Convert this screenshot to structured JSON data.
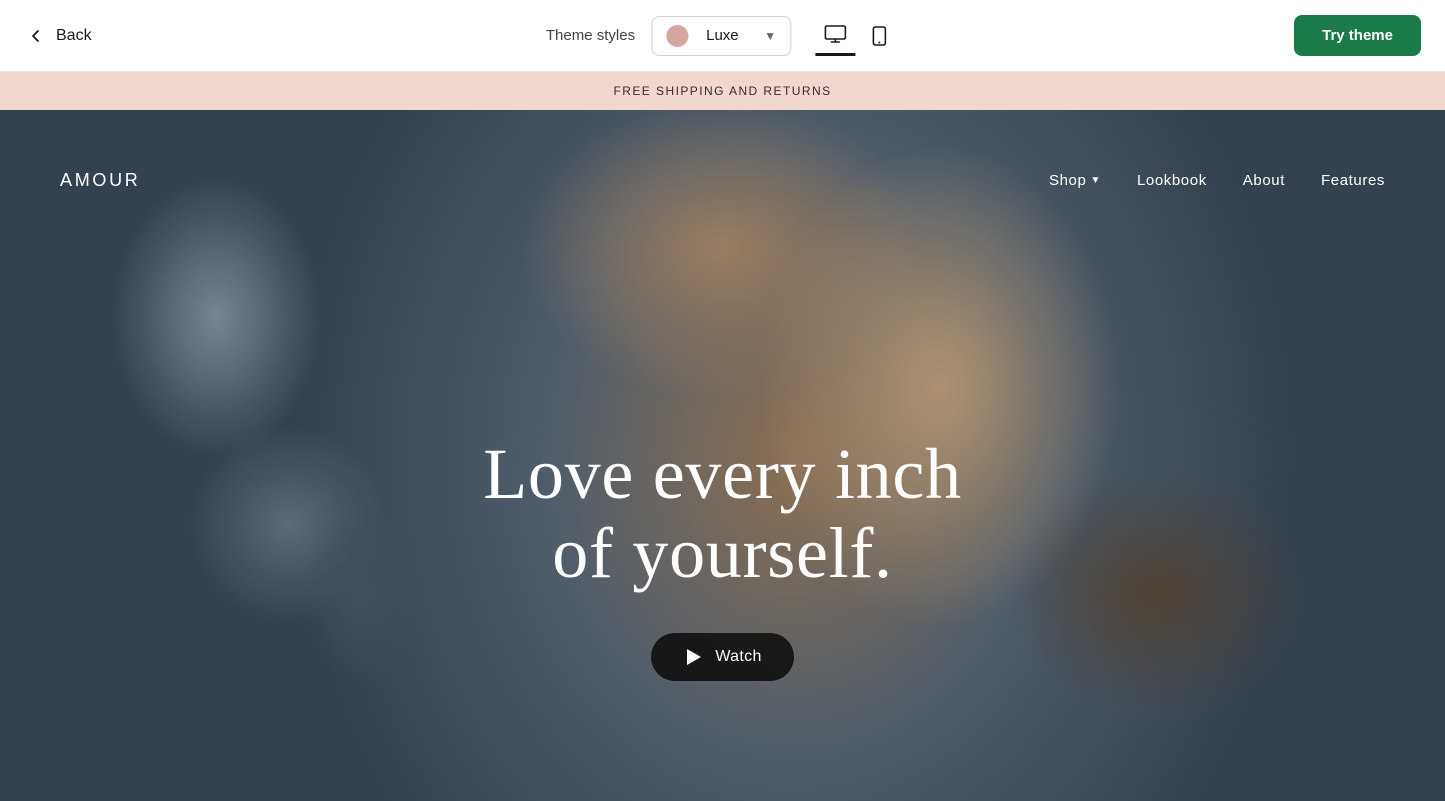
{
  "toolbar": {
    "back_label": "Back",
    "theme_styles_label": "Theme styles",
    "dropdown": {
      "color": "#d4a8a0",
      "name": "Luxe"
    },
    "try_theme_button": "Try theme",
    "device_desktop_icon": "desktop",
    "device_mobile_icon": "mobile"
  },
  "preview": {
    "announcement_bar": "FREE SHIPPING AND RETURNS",
    "store": {
      "logo": "AMOUR",
      "nav_links": [
        {
          "label": "Shop",
          "has_dropdown": true
        },
        {
          "label": "Lookbook",
          "has_dropdown": false
        },
        {
          "label": "About",
          "has_dropdown": false
        },
        {
          "label": "Features",
          "has_dropdown": false
        }
      ]
    },
    "hero": {
      "title_line1": "Love every inch",
      "title_line2": "of yourself.",
      "watch_button": "Watch"
    }
  }
}
